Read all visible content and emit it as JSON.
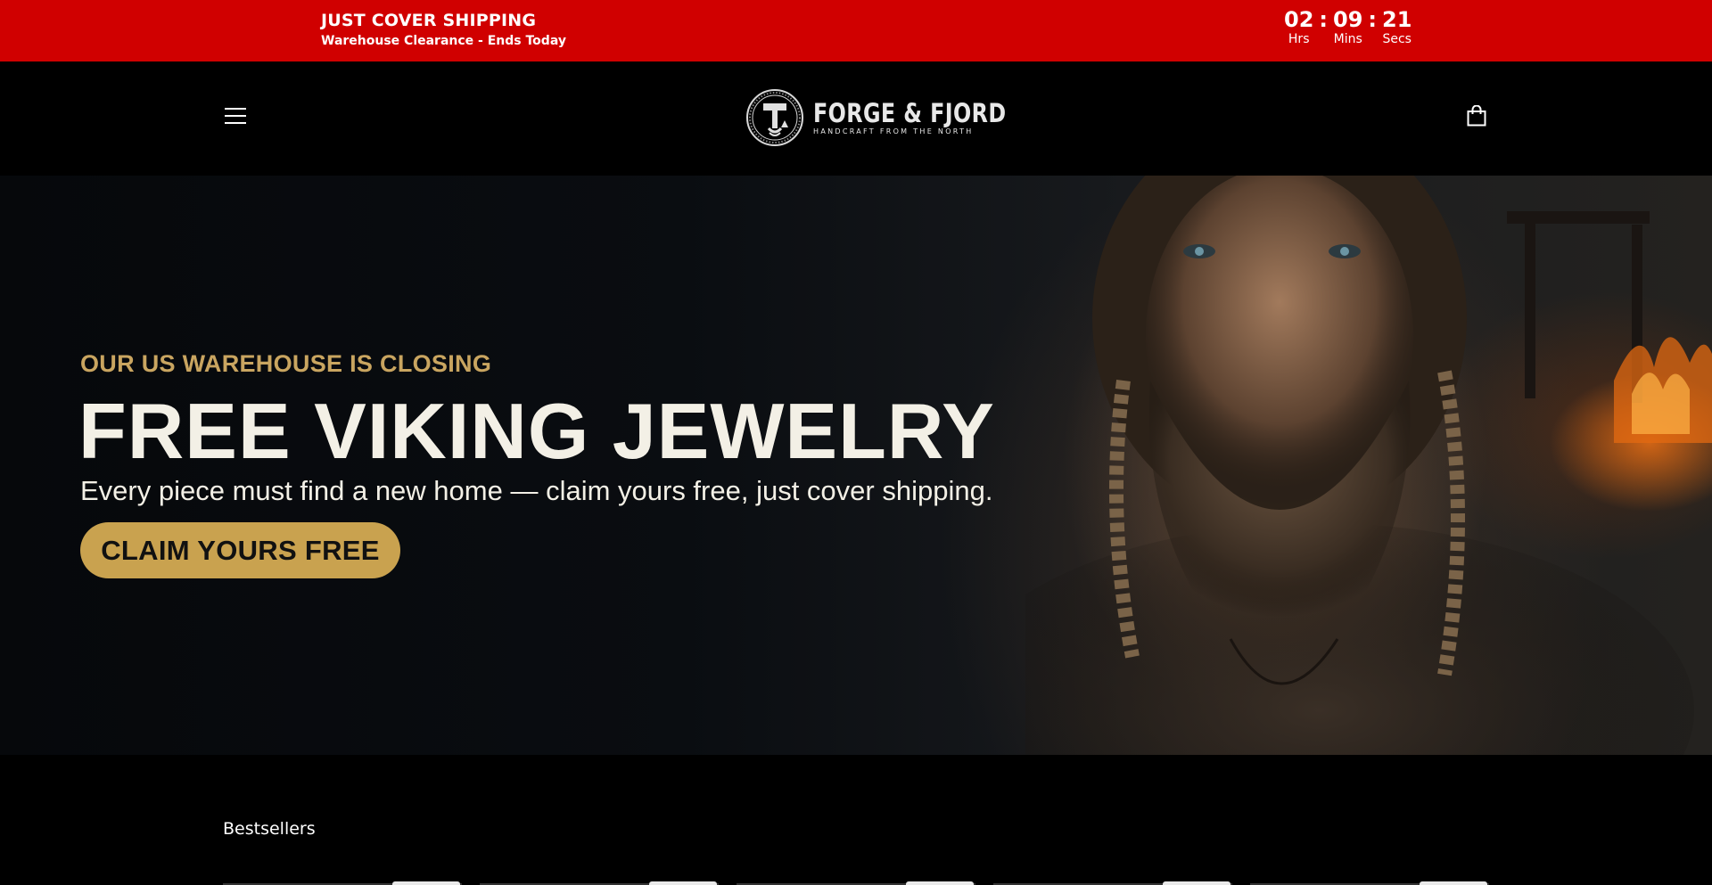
{
  "announcement": {
    "title": "JUST COVER SHIPPING",
    "subtitle": "Warehouse Clearance - Ends Today",
    "background_color": "#d00000",
    "countdown": {
      "hours": "02",
      "minutes": "09",
      "seconds": "21",
      "separator": ":",
      "hours_label": "Hrs",
      "minutes_label": "Mins",
      "seconds_label": "Secs"
    }
  },
  "header": {
    "menu_icon": "hamburger-menu-icon",
    "logo_name": "FORGE & FJORD",
    "logo_tagline": "HANDCRAFT FROM THE NORTH",
    "cart_icon": "shopping-bag-icon"
  },
  "hero": {
    "eyebrow": "OUR US WAREHOUSE IS CLOSING",
    "title": "FREE VIKING JEWELRY",
    "subtitle": "Every piece must find a new home — claim yours free, just cover shipping.",
    "cta_label": "CLAIM YOURS FREE",
    "accent_color": "#c9a24f"
  },
  "bestsellers": {
    "title": "Bestsellers"
  }
}
